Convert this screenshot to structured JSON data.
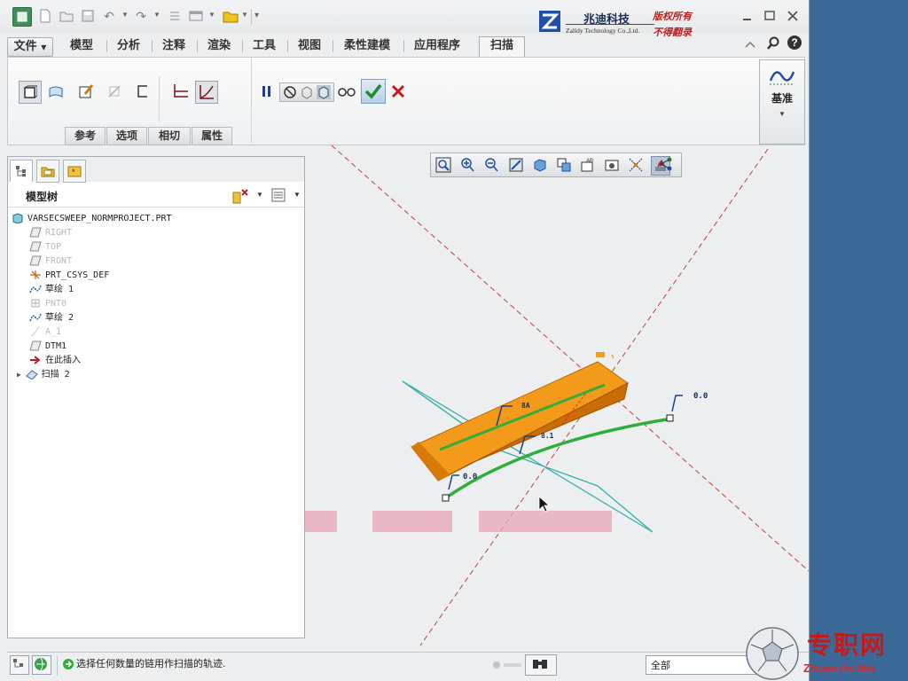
{
  "logo": {
    "company_cn": "兆迪科技",
    "company_en": "Zalldy Technology Co.,Ltd.",
    "rights_line1": "版权所有",
    "rights_line2": "不得翻录"
  },
  "tabs": [
    "文件",
    "模型",
    "分析",
    "注释",
    "渲染",
    "工具",
    "视图",
    "柔性建模",
    "应用程序",
    "扫描"
  ],
  "ribbon": {
    "subtabs": [
      "参考",
      "选项",
      "相切",
      "属性"
    ],
    "datum_label": "基准"
  },
  "model_tree": {
    "title": "模型树",
    "items": [
      {
        "label": "VARSECSWEEP_NORMPROJECT.PRT",
        "icon": "part-icon",
        "dim": false
      },
      {
        "label": "RIGHT",
        "icon": "datum-plane-icon",
        "dim": true
      },
      {
        "label": "TOP",
        "icon": "datum-plane-icon",
        "dim": true
      },
      {
        "label": "FRONT",
        "icon": "datum-plane-icon",
        "dim": true
      },
      {
        "label": "PRT_CSYS_DEF",
        "icon": "csys-icon",
        "dim": false
      },
      {
        "label": "草绘 1",
        "icon": "sketch-icon",
        "dim": false
      },
      {
        "label": "PNT0",
        "icon": "datum-point-icon",
        "dim": true
      },
      {
        "label": "草绘 2",
        "icon": "sketch-icon",
        "dim": false
      },
      {
        "label": "A_1",
        "icon": "datum-axis-icon",
        "dim": true
      },
      {
        "label": "DTM1",
        "icon": "datum-plane-icon",
        "dim": false
      },
      {
        "label": "在此插入",
        "icon": "insert-here-arrow-icon",
        "dim": false
      },
      {
        "label": "扫描 2",
        "icon": "sweep-feature-icon",
        "dim": false
      }
    ]
  },
  "graphics": {
    "dim_label_1": "0.0",
    "dim_label_2": "0.0",
    "dim_label_3": "8A",
    "dim_label_4": "8.1"
  },
  "status": {
    "message": "选择任何数量的链用作扫描的轨迹.",
    "filter_value": "全部"
  },
  "watermark": {
    "text_cn": "专职网",
    "text_en": "Zhuanzhi.Net"
  },
  "colors": {
    "accent_blue": "#1f4fa8",
    "solid_orange": "#ee8a10",
    "trajectory_green": "#2fae3a",
    "cyan_plane": "#37b0a8",
    "datum_red": "#c04040"
  }
}
